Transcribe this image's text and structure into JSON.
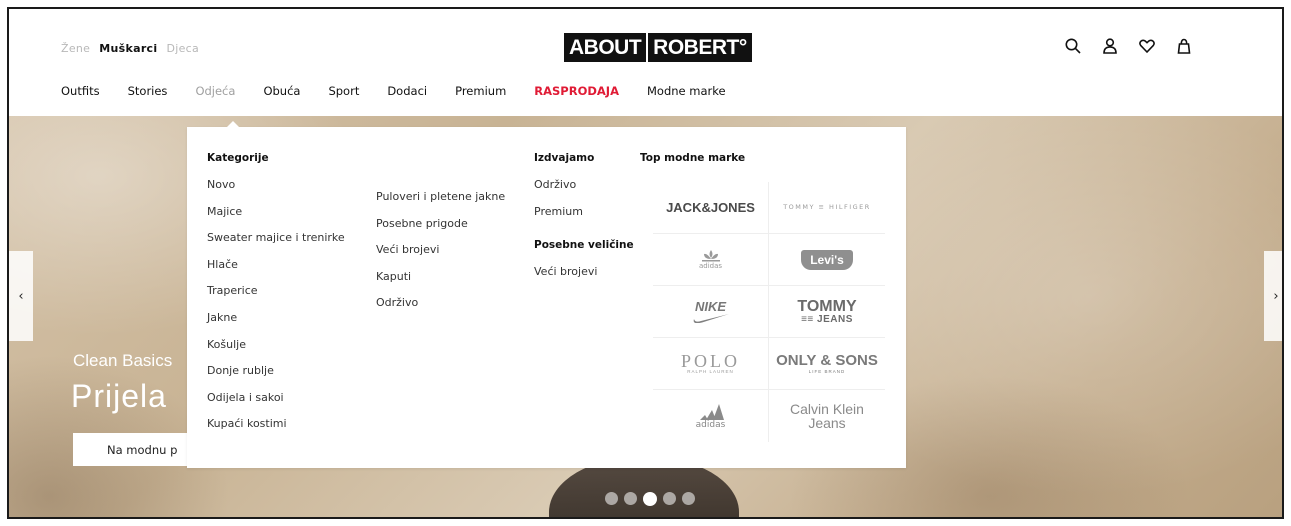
{
  "header": {
    "gender_tabs": [
      "Žene",
      "Muškarci",
      "Djeca"
    ],
    "logo": {
      "part1": "ABOUT",
      "part2": "ROBERT°"
    },
    "icons": [
      "search-icon",
      "user-icon",
      "heart-icon",
      "bag-icon"
    ]
  },
  "nav": {
    "items": [
      "Outfits",
      "Stories",
      "Odjeća",
      "Obuća",
      "Sport",
      "Dodaci",
      "Premium",
      "RASPRODAJA",
      "Modne marke"
    ],
    "active": "Odjeća",
    "sale_color": "#e01b35"
  },
  "hero": {
    "subtitle": "Clean Basics",
    "title": "Prijela",
    "cta": "Na modnu p",
    "prev_arrow": "‹",
    "next_arrow": "›",
    "slides_count": 5,
    "active_slide": 3
  },
  "mega_menu": {
    "categories_heading": "Kategorije",
    "categories_col1": [
      "Novo",
      "Majice",
      "Sweater majice i trenirke",
      "Hlače",
      "Traperice",
      "Jakne",
      "Košulje",
      "Donje rublje",
      "Odijela i sakoi",
      "Kupaći kostimi"
    ],
    "categories_col2": [
      "Puloveri i pletene jakne",
      "Posebne prigode",
      "Veći brojevi",
      "Kaputi",
      "Održivo"
    ],
    "highlights_heading": "Izdvajamo",
    "highlights": [
      "Održivo",
      "Premium"
    ],
    "sizes_heading": "Posebne veličine",
    "sizes": [
      "Veći brojevi"
    ],
    "brands_heading": "Top modne marke",
    "brands": {
      "jack_jones": "JACK&JONES",
      "tommy_hilfiger": "TOMMY ≡ HILFIGER",
      "adidas_originals": "adidas",
      "levis": "Levi's",
      "nike": "NIKE",
      "tommy_jeans_1": "TOMMY",
      "tommy_jeans_2": "≡≡ JEANS",
      "polo": "POLO",
      "polo_sub": "RALPH LAUREN",
      "only_sons": "ONLY & SONS",
      "only_sons_sub": "LIFE BRAND",
      "adidas": "adidas",
      "calvin_klein_1": "Calvin Klein",
      "calvin_klein_2": "Jeans"
    }
  }
}
